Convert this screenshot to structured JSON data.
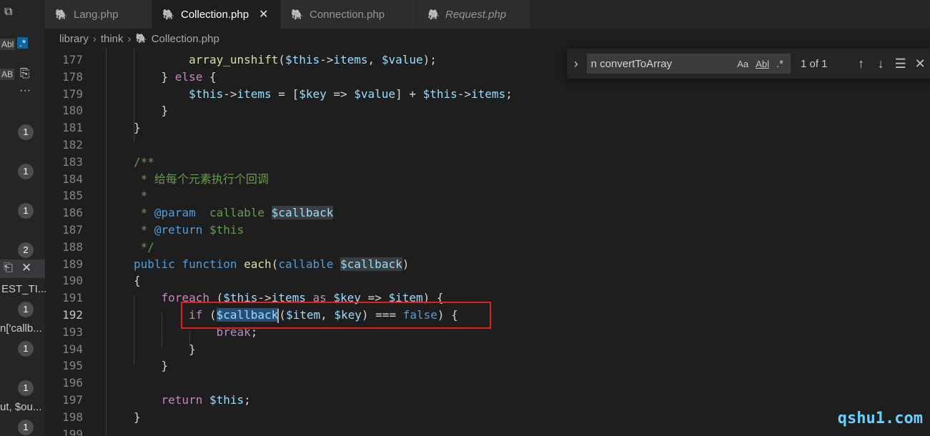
{
  "tabs": [
    {
      "label": "Lang.php",
      "active": false,
      "italic": false
    },
    {
      "label": "Collection.php",
      "active": true,
      "italic": false
    },
    {
      "label": "Connection.php",
      "active": false,
      "italic": false
    },
    {
      "label": "Request.php",
      "active": false,
      "italic": true
    }
  ],
  "tab_close_glyph": "✕",
  "breadcrumb": [
    "library",
    "think",
    "Collection.php"
  ],
  "find": {
    "value": "n convertToArray",
    "match_case": "Aa",
    "whole_word": "Abl",
    "regex": ".*",
    "count": "1 of 1"
  },
  "left_panel": {
    "ab_label": "AB",
    "more": "···",
    "badges": [
      "1",
      "1",
      "1",
      "2",
      "1",
      "1",
      "1",
      "1"
    ],
    "snippets": [
      "EST_TI...",
      "n['callb...",
      "ut, $ou..."
    ]
  },
  "code_lines": [
    {
      "n": "177",
      "html": "        <span class='fn'>array_unshift</span>(<span class='var'>$this</span>-><span class='var'>items</span>, <span class='var'>$value</span>);"
    },
    {
      "n": "178",
      "html": "    } <span class='kw2'>else</span> {"
    },
    {
      "n": "179",
      "html": "        <span class='var'>$this</span>-><span class='var'>items</span> = [<span class='var'>$key</span> => <span class='var'>$value</span>] + <span class='var'>$this</span>-><span class='var'>items</span>;"
    },
    {
      "n": "180",
      "html": "    }"
    },
    {
      "n": "181",
      "html": "}"
    },
    {
      "n": "182",
      "html": ""
    },
    {
      "n": "183",
      "html": "<span class='cm'>/**</span>"
    },
    {
      "n": "184",
      "html": "<span class='cm'> * 给每个元素执行个回调</span>"
    },
    {
      "n": "185",
      "html": "<span class='cm'> *</span>"
    },
    {
      "n": "186",
      "html": "<span class='cm'> * </span><span class='kw'>@param</span><span class='cm'>  callable </span><span class='var hl2'>$callback</span>"
    },
    {
      "n": "187",
      "html": "<span class='cm'> * </span><span class='kw'>@return</span><span class='cm'> $this</span>"
    },
    {
      "n": "188",
      "html": "<span class='cm'> */</span>"
    },
    {
      "n": "189",
      "html": "<span class='kw'>public</span> <span class='kw'>function</span> <span class='fn'>each</span>(<span class='kw'>callable</span> <span class='var hl2'>$callback</span>)"
    },
    {
      "n": "190",
      "html": "{"
    },
    {
      "n": "191",
      "html": "    <span class='kw2'>foreach</span> (<span class='var'>$this</span>-><span class='var'>items</span> <span class='kw2'>as</span> <span class='var'>$key</span> => <span class='var'>$item</span>) {"
    },
    {
      "n": "192",
      "html": "        <span class='kw2'>if</span> (<span class='var hl'>$callback</span><span class='cursor'></span>(<span class='var'>$item</span>, <span class='var'>$key</span>) === <span class='kw'>false</span>) {"
    },
    {
      "n": "193",
      "html": "            <span class='kw2'>break</span>;"
    },
    {
      "n": "194",
      "html": "        }"
    },
    {
      "n": "195",
      "html": "    }"
    },
    {
      "n": "196",
      "html": ""
    },
    {
      "n": "197",
      "html": "    <span class='kw2'>return</span> <span class='var'>$this</span>;"
    },
    {
      "n": "198",
      "html": "}"
    },
    {
      "n": "199",
      "html": ""
    }
  ],
  "current_line": "192",
  "watermark": "qshu1.com"
}
